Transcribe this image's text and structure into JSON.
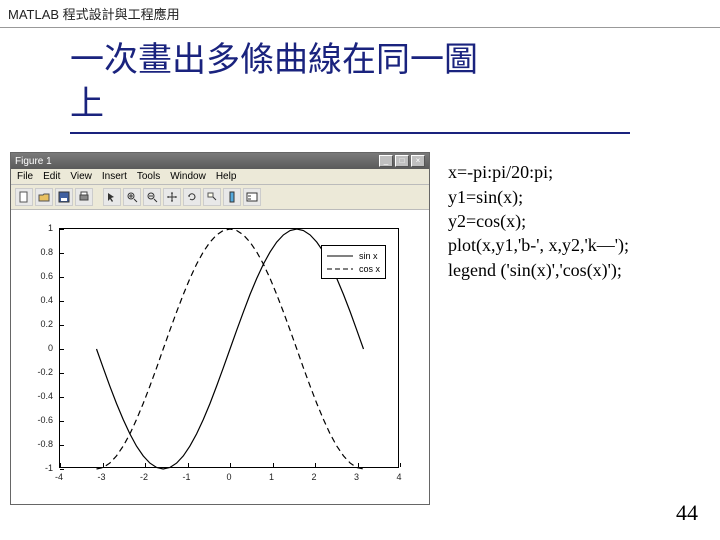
{
  "header": {
    "course": "MATLAB 程式設計與工程應用"
  },
  "title": {
    "line1": "一次畫出多條曲線在同一圖",
    "line2": "上"
  },
  "figure": {
    "window_title": "Figure 1",
    "menu": [
      "File",
      "Edit",
      "View",
      "Insert",
      "Tools",
      "Window",
      "Help"
    ],
    "toolbar_icons": [
      "new",
      "open",
      "save",
      "print",
      "arrow",
      "zoom-in",
      "zoom-out",
      "pan",
      "rotate",
      "data-cursor",
      "colorbar",
      "legend"
    ],
    "win_btns": {
      "min": "_",
      "max": "□",
      "close": "×"
    }
  },
  "legend": {
    "items": [
      {
        "label": "sin x",
        "style": "solid"
      },
      {
        "label": "cos x",
        "style": "dash"
      }
    ]
  },
  "code": {
    "l1": "x=-pi:pi/20:pi;",
    "l2": "y1=sin(x);",
    "l3": "y2=cos(x);",
    "l4": "plot(x,y1,'b-', x,y2,'k—');",
    "l5": "legend ('sin(x)','cos(x)');"
  },
  "page_number": "44",
  "chart_data": {
    "type": "line",
    "xlabel": "",
    "ylabel": "",
    "xlim": [
      -4,
      4
    ],
    "ylim": [
      -1,
      1
    ],
    "xticks": [
      -4,
      -3,
      -2,
      -1,
      0,
      1,
      2,
      3,
      4
    ],
    "yticks": [
      -1,
      -0.8,
      -0.6,
      -0.4,
      -0.2,
      0,
      0.2,
      0.4,
      0.6,
      0.8,
      1
    ],
    "series": [
      {
        "name": "sin x",
        "style": "solid",
        "x": [
          -3.1416,
          -2.9845,
          -2.8274,
          -2.6704,
          -2.5133,
          -2.3562,
          -2.1991,
          -2.042,
          -1.885,
          -1.7279,
          -1.5708,
          -1.4137,
          -1.2566,
          -1.0996,
          -0.9425,
          -0.7854,
          -0.6283,
          -0.4712,
          -0.3142,
          -0.1571,
          0,
          0.1571,
          0.3142,
          0.4712,
          0.6283,
          0.7854,
          0.9425,
          1.0996,
          1.2566,
          1.4137,
          1.5708,
          1.7279,
          1.885,
          2.042,
          2.1991,
          2.3562,
          2.5133,
          2.6704,
          2.8274,
          2.9845,
          3.1416
        ],
        "y": [
          0,
          -0.1564,
          -0.309,
          -0.454,
          -0.5878,
          -0.7071,
          -0.809,
          -0.891,
          -0.9511,
          -0.9877,
          -1,
          -0.9877,
          -0.9511,
          -0.891,
          -0.809,
          -0.7071,
          -0.5878,
          -0.454,
          -0.309,
          -0.1564,
          0,
          0.1564,
          0.309,
          0.454,
          0.5878,
          0.7071,
          0.809,
          0.891,
          0.9511,
          0.9877,
          1,
          0.9877,
          0.9511,
          0.891,
          0.809,
          0.7071,
          0.5878,
          0.454,
          0.309,
          0.1564,
          0
        ]
      },
      {
        "name": "cos x",
        "style": "dash",
        "x": [
          -3.1416,
          -2.9845,
          -2.8274,
          -2.6704,
          -2.5133,
          -2.3562,
          -2.1991,
          -2.042,
          -1.885,
          -1.7279,
          -1.5708,
          -1.4137,
          -1.2566,
          -1.0996,
          -0.9425,
          -0.7854,
          -0.6283,
          -0.4712,
          -0.3142,
          -0.1571,
          0,
          0.1571,
          0.3142,
          0.4712,
          0.6283,
          0.7854,
          0.9425,
          1.0996,
          1.2566,
          1.4137,
          1.5708,
          1.7279,
          1.885,
          2.042,
          2.1991,
          2.3562,
          2.5133,
          2.6704,
          2.8274,
          2.9845,
          3.1416
        ],
        "y": [
          -1,
          -0.9877,
          -0.9511,
          -0.891,
          -0.809,
          -0.7071,
          -0.5878,
          -0.454,
          -0.309,
          -0.1564,
          0,
          0.1564,
          0.309,
          0.454,
          0.5878,
          0.7071,
          0.809,
          0.891,
          0.9511,
          0.9877,
          1,
          0.9877,
          0.9511,
          0.891,
          0.809,
          0.7071,
          0.5878,
          0.454,
          0.309,
          0.1564,
          0,
          -0.1564,
          -0.309,
          -0.454,
          -0.5878,
          -0.7071,
          -0.809,
          -0.891,
          -0.9511,
          -0.9877,
          -1
        ]
      }
    ]
  }
}
